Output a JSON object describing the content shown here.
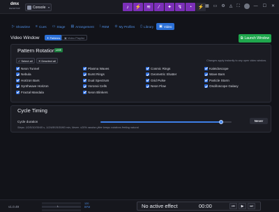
{
  "app": {
    "logo_line1": "dmx",
    "logo_line2": "DESKTOP",
    "console_label": "Console"
  },
  "toolbar": {
    "fx_buttons": [
      {
        "icon": "music-icon",
        "glyph": "♪"
      },
      {
        "icon": "bolt-icon",
        "glyph": "⚡"
      },
      {
        "icon": "waveform-icon",
        "glyph": "≋"
      },
      {
        "icon": "wand-icon",
        "glyph": "⁄"
      },
      {
        "icon": "sparkle-icon",
        "glyph": "✦"
      },
      {
        "icon": "lightning-icon",
        "glyph": "↯"
      },
      {
        "icon": "gauge-icon",
        "glyph": "◔"
      },
      {
        "icon": "bolt-alt-icon",
        "glyph": "⚡"
      }
    ]
  },
  "tabs": [
    {
      "label": "Showtime",
      "icon": "play-icon",
      "glyph": "▷",
      "active": false
    },
    {
      "label": "Cues",
      "icon": "list-icon",
      "glyph": "≡",
      "active": false
    },
    {
      "label": "Stage",
      "icon": "stage-icon",
      "glyph": "▭",
      "active": false
    },
    {
      "label": "Arrangement",
      "icon": "timeline-icon",
      "glyph": "▤",
      "active": false
    },
    {
      "label": "REM",
      "icon": "dots-icon",
      "glyph": "⁞",
      "active": false
    },
    {
      "label": "My Profiles",
      "icon": "profile-icon",
      "glyph": "⊙",
      "active": false
    },
    {
      "label": "Library",
      "icon": "book-icon",
      "glyph": "▯",
      "active": false
    },
    {
      "label": "Video",
      "icon": "video-icon",
      "glyph": "▣",
      "active": true
    }
  ],
  "header": {
    "title": "Video Window",
    "chip_patterns": "Patterns",
    "chip_playlist": "Video Playlist",
    "launch_label": "Launch Window"
  },
  "rotation": {
    "title": "Pattern Rotation",
    "badge": "LIVE",
    "select_all": "Select all",
    "deselect_all": "Deselect all",
    "hint": "Changes apply instantly to any open video window.",
    "patterns": [
      [
        "Neon Tunnel",
        "Plasma Waves",
        "Cosmic Rings",
        "Kaleidoscope"
      ],
      [
        "Nebula",
        "Burst Rings",
        "Geometric Shatter",
        "Wave Bars"
      ],
      [
        "Horizon Bars",
        "Dual Spectrum",
        "Grid Pulse",
        "Particle Storm"
      ],
      [
        "Synthwave Horizon",
        "Voronoi Cells",
        "Neon Flow",
        "Oscilloscope Galaxy"
      ],
      [
        "Fractal Mandala",
        "Neon Blinkers",
        "",
        ""
      ]
    ]
  },
  "timing": {
    "title": "Cycle Timing",
    "duration_label": "Cycle duration",
    "slider_fraction": 0.92,
    "never_label": "Never",
    "steps_note": "Steps: 1/2/5/10/30/45 s, 1/2/4/8/15/30/60 min, Never. ±20% random jitter keeps rotations feeling natural."
  },
  "statusbar": {
    "version": "v1.0.49",
    "mini_label": "L",
    "bpm_value": "120",
    "bpm_label": "BPM",
    "active_effect": "No active effect",
    "time": "00:00",
    "transport": [
      {
        "icon": "skip-back-icon",
        "glyph": "⏮"
      },
      {
        "icon": "play-icon",
        "glyph": "▶"
      },
      {
        "icon": "skip-forward-icon",
        "glyph": "⏭"
      }
    ]
  }
}
